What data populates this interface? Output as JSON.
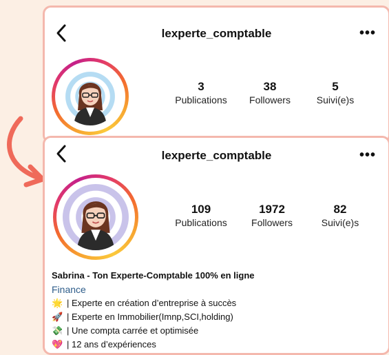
{
  "top_profile": {
    "username": "lexperte_comptable",
    "stats": [
      {
        "value": "3",
        "label": "Publications"
      },
      {
        "value": "38",
        "label": "Followers"
      },
      {
        "value": "5",
        "label": "Suivi(e)s"
      }
    ]
  },
  "bottom_profile": {
    "username": "lexperte_comptable",
    "stats": [
      {
        "value": "109",
        "label": "Publications"
      },
      {
        "value": "1972",
        "label": "Followers"
      },
      {
        "value": "82",
        "label": "Suivi(e)s"
      }
    ],
    "bio": {
      "name": "Sabrina - Ton Experte-Comptable 100% en ligne",
      "category": "Finance",
      "lines": [
        {
          "emoji": "🌟",
          "text": "| Experte en création d’entreprise à succès"
        },
        {
          "emoji": "🚀",
          "text": "| Experte en Immobilier(Imnp,SCI,holding)"
        },
        {
          "emoji": "💸",
          "text": "| Une compta carrée et optimisée"
        },
        {
          "emoji": "💖",
          "text": "| 12 ans d’expériences"
        }
      ]
    }
  },
  "colors": {
    "page_bg": "#fcefe4",
    "card_border": "#f4b8ad",
    "arrow": "#ef6a5a",
    "category_link": "#2e5d8a"
  },
  "icons": {
    "back": "chevron-left-icon",
    "more": "more-dots-icon"
  }
}
